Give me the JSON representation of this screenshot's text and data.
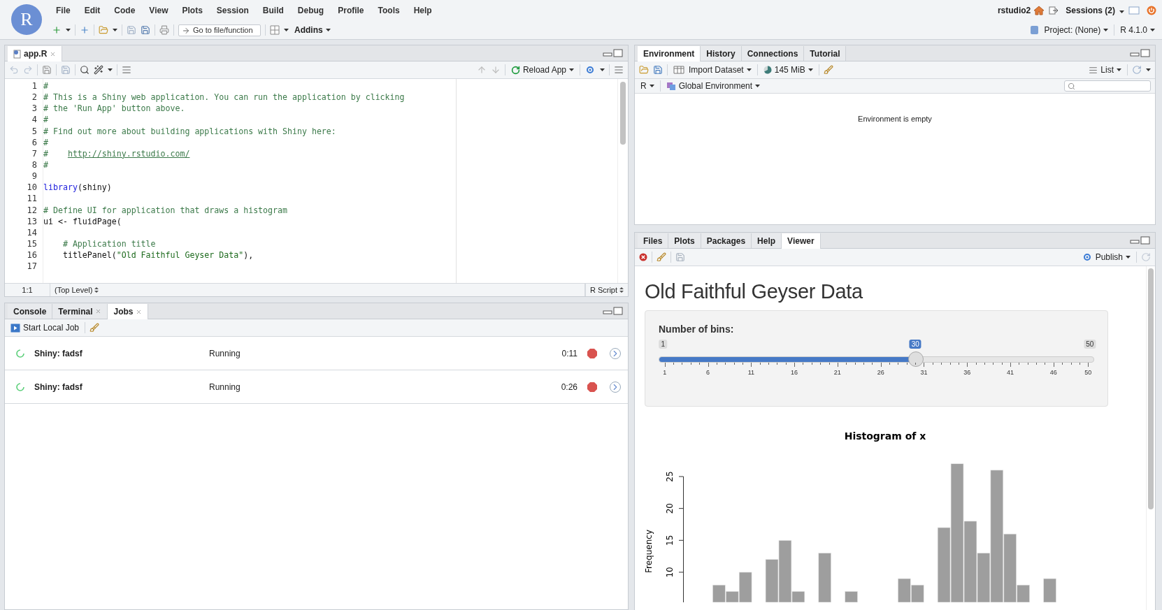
{
  "app_logo": "R",
  "menu": [
    "File",
    "Edit",
    "Code",
    "View",
    "Plots",
    "Session",
    "Build",
    "Debug",
    "Profile",
    "Tools",
    "Help"
  ],
  "session": {
    "user": "rstudio2",
    "sessions": "Sessions (2)"
  },
  "toolbar": {
    "goto_placeholder": "Go to file/function",
    "addins": "Addins",
    "project": "Project: (None)",
    "r_version": "R 4.1.0"
  },
  "editor": {
    "tabs": [
      {
        "label": "app.R",
        "selected": true
      }
    ],
    "reload": "Reload App",
    "lines": [
      {
        "number": "1",
        "segments": [
          {
            "kind": "comment",
            "text": "#"
          }
        ]
      },
      {
        "number": "2",
        "segments": [
          {
            "kind": "comment",
            "text": "# This is a Shiny web application. You can run the application by clicking"
          }
        ]
      },
      {
        "number": "3",
        "segments": [
          {
            "kind": "comment",
            "text": "# the 'Run App' button above."
          }
        ]
      },
      {
        "number": "4",
        "segments": [
          {
            "kind": "comment",
            "text": "#"
          }
        ]
      },
      {
        "number": "5",
        "segments": [
          {
            "kind": "comment",
            "text": "# Find out more about building applications with Shiny here:"
          }
        ]
      },
      {
        "number": "6",
        "segments": [
          {
            "kind": "comment",
            "text": "#"
          }
        ]
      },
      {
        "number": "7",
        "segments": [
          {
            "kind": "comment",
            "text": "#    "
          },
          {
            "kind": "link",
            "text": "http://shiny.rstudio.com/"
          }
        ]
      },
      {
        "number": "8",
        "segments": [
          {
            "kind": "comment",
            "text": "#"
          }
        ]
      },
      {
        "number": "9"
      },
      {
        "number": "10",
        "segments": [
          {
            "kind": "keyword",
            "text": "library"
          },
          {
            "kind": "plain",
            "text": "(shiny)"
          }
        ]
      },
      {
        "number": "11"
      },
      {
        "number": "12",
        "segments": [
          {
            "kind": "comment",
            "text": "# Define UI for application that draws a histogram"
          }
        ]
      },
      {
        "number": "13",
        "segments": [
          {
            "kind": "plain",
            "text": "ui <- fluidPage("
          }
        ]
      },
      {
        "number": "14"
      },
      {
        "number": "15",
        "segments": [
          {
            "kind": "comment",
            "text": "    # Application title"
          }
        ]
      },
      {
        "number": "16",
        "segments": [
          {
            "kind": "plain",
            "text": "    titlePanel("
          },
          {
            "kind": "string",
            "text": "\"Old Faithful Geyser Data\""
          },
          {
            "kind": "plain",
            "text": "),"
          }
        ]
      },
      {
        "number": "17"
      }
    ],
    "status": {
      "position": "1:1",
      "scope": "(Top Level)",
      "filetype": "R Script"
    }
  },
  "console": {
    "tabs": [
      {
        "label": "Console",
        "selected": false,
        "closable": false
      },
      {
        "label": "Terminal",
        "selected": false,
        "closable": true
      },
      {
        "label": "Jobs",
        "selected": true,
        "closable": true
      }
    ],
    "start_job": "Start Local Job",
    "jobs": [
      {
        "name": "Shiny: fadsf",
        "status": "Running",
        "elapsed": "0:11"
      },
      {
        "name": "Shiny: fadsf",
        "status": "Running",
        "elapsed": "0:26"
      }
    ]
  },
  "environment": {
    "tabs": [
      {
        "label": "Environment",
        "selected": true
      },
      {
        "label": "History",
        "selected": false
      },
      {
        "label": "Connections",
        "selected": false
      },
      {
        "label": "Tutorial",
        "selected": false
      }
    ],
    "import": "Import Dataset",
    "memory": "145 MiB",
    "view": "List",
    "language": "R",
    "scope": "Global Environment",
    "empty_message": "Environment is empty"
  },
  "viewer": {
    "tabs": [
      {
        "label": "Files",
        "selected": false
      },
      {
        "label": "Plots",
        "selected": false
      },
      {
        "label": "Packages",
        "selected": false
      },
      {
        "label": "Help",
        "selected": false
      },
      {
        "label": "Viewer",
        "selected": true
      }
    ],
    "publish": "Publish",
    "app": {
      "title": "Old Faithful Geyser Data",
      "input_label": "Number of bins:",
      "slider": {
        "min": "1",
        "max": "50",
        "value": "30",
        "level": 0.592,
        "ticks": [
          "1",
          "6",
          "11",
          "16",
          "21",
          "26",
          "31",
          "36",
          "41",
          "46",
          "50"
        ]
      },
      "histogram": {
        "title": "Histogram of x",
        "ylabel": "Frequency",
        "yticks": [
          "10",
          "15",
          "20",
          "25"
        ]
      }
    }
  }
}
